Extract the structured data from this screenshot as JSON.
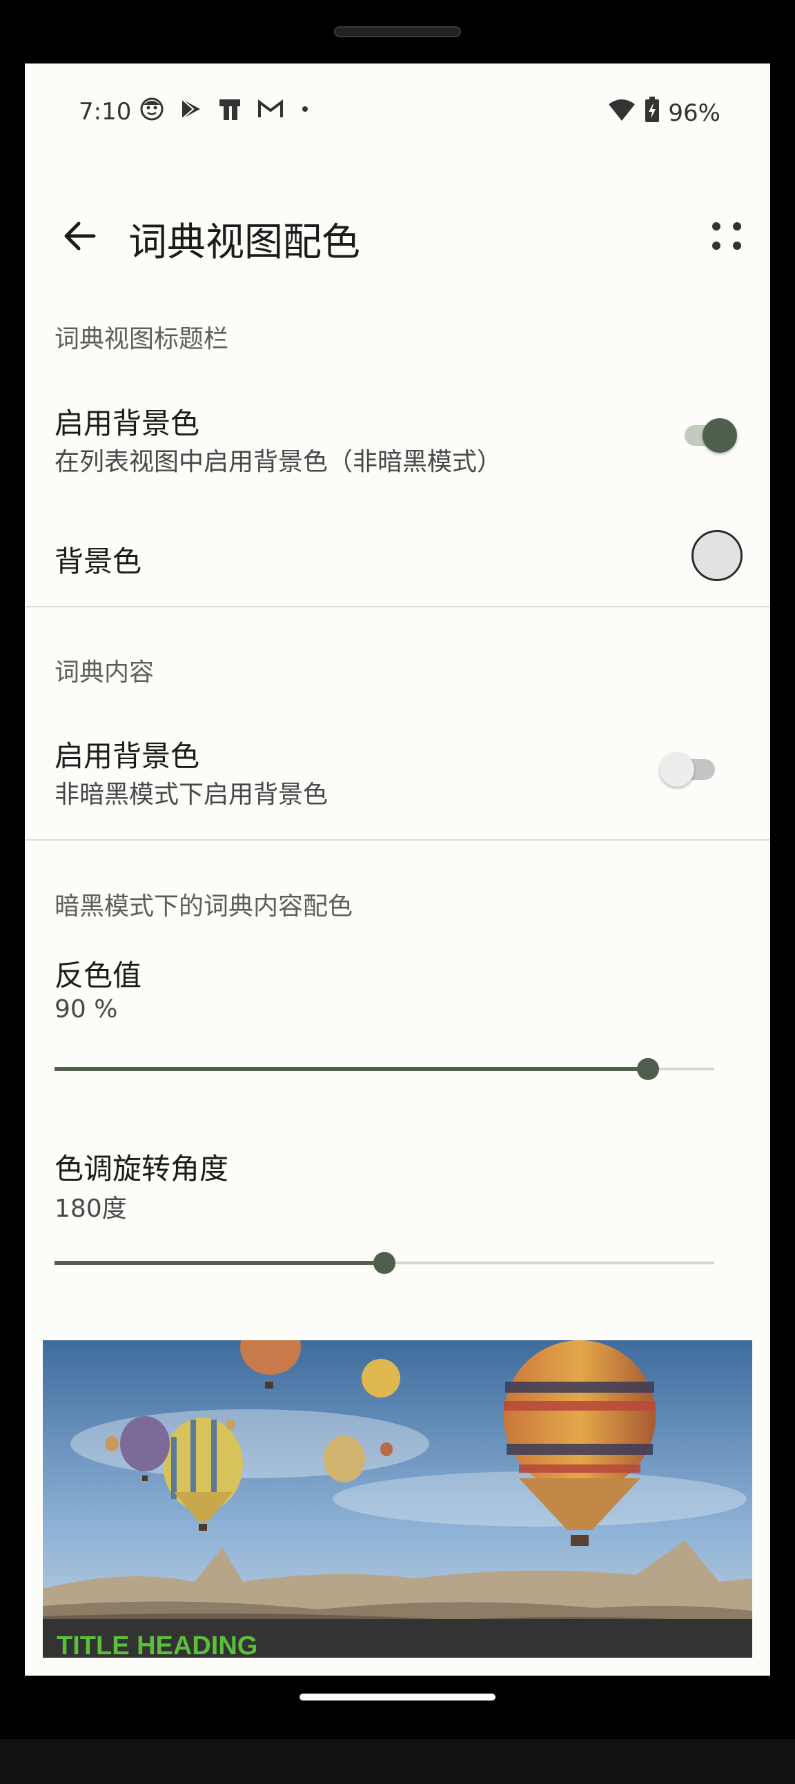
{
  "status_bar": {
    "time": "7:10",
    "battery": "96%",
    "left_icons": [
      "face-icon",
      "play-store-icon",
      "device-icon",
      "gmail-icon",
      "dot-icon"
    ],
    "right_icons": [
      "wifi-icon",
      "battery-charging-icon"
    ]
  },
  "app_bar": {
    "title": "词典视图配色",
    "back_icon": "arrow-back-icon",
    "more_icon": "more-dots-icon"
  },
  "sections": {
    "title_bar": {
      "header": "词典视图标题栏",
      "enable_bg": {
        "title": "启用背景色",
        "summary": "在列表视图中启用背景色（非暗黑模式）",
        "checked": true
      },
      "bg_color": {
        "title": "背景色",
        "color": "#e2e2e4"
      }
    },
    "content": {
      "header": "词典内容",
      "enable_bg": {
        "title": "启用背景色",
        "summary": "非暗黑模式下启用背景色",
        "checked": false
      }
    },
    "dark_mode": {
      "header": "暗黑模式下的词典内容配色",
      "invert": {
        "title": "反色值",
        "value_text": "90 %",
        "value": 90,
        "max": 100
      },
      "hue": {
        "title": "色调旋转角度",
        "value_text": "180度",
        "value": 180,
        "max": 360
      }
    }
  },
  "preview": {
    "title": "TITLE HEADING",
    "image": "hot-air-balloons-landscape"
  },
  "colors": {
    "accent": "#4f5e4d",
    "background": "#fcfcf8",
    "preview_title": "#5bbf3a"
  }
}
